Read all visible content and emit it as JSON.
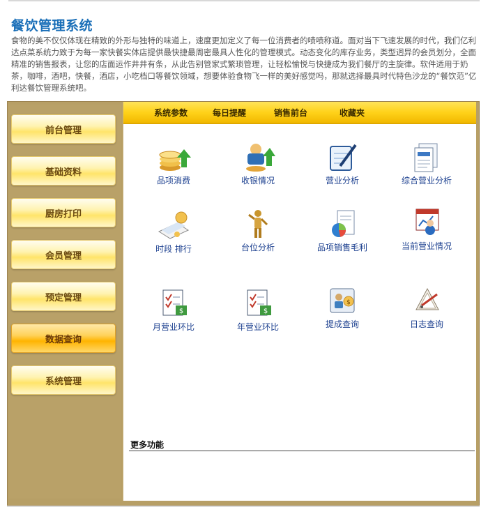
{
  "page": {
    "title": "餐饮管理系统",
    "intro": "食物的美不仅仅体现在精致的外形与独特的味道上，速度更加定义了每一位消费者的啧啧称道。面对当下飞速发展的时代，我们亿利达点菜系统力致于为每一家快餐实体店提供最快捷最周密最具人性化的管理模式。动态变化的库存业务，类型迥异的会员划分，全面精准的销售报表，让您的店面运作井井有条，从此告别管家式繁琐管理，让轻松愉悦与快捷成为我们餐厅的主旋律。软件适用于奶茶，咖啡，酒吧，快餐，酒店，小吃档口等餐饮领域，想要体验食物飞一样的美好感觉吗，那就选择最具时代特色沙龙的“餐饮范”亿利达餐饮管理系统吧。"
  },
  "sidebar": {
    "items": [
      {
        "label": "前台管理",
        "active": false
      },
      {
        "label": "基础资料",
        "active": false
      },
      {
        "label": "厨房打印",
        "active": false
      },
      {
        "label": "会员管理",
        "active": false
      },
      {
        "label": "预定管理",
        "active": false
      },
      {
        "label": "数据查询",
        "active": true
      },
      {
        "label": "系统管理",
        "active": false
      }
    ]
  },
  "tabs": [
    {
      "label": "系统参数"
    },
    {
      "label": "每日提醒"
    },
    {
      "label": "销售前台"
    },
    {
      "label": "收藏夹"
    }
  ],
  "tiles": [
    {
      "label": "品项消费",
      "icon": "coins-chart-icon"
    },
    {
      "label": "收银情况",
      "icon": "cashier-icon"
    },
    {
      "label": "营业分析",
      "icon": "notebook-pen-icon"
    },
    {
      "label": "综合营业分析",
      "icon": "document-report-icon"
    },
    {
      "label": "时段 排行",
      "icon": "time-ranking-icon"
    },
    {
      "label": "台位分析",
      "icon": "figure-icon"
    },
    {
      "label": "品项销售毛利",
      "icon": "pie-document-icon"
    },
    {
      "label": "当前营业情况",
      "icon": "current-status-icon"
    },
    {
      "label": "月营业环比",
      "icon": "checklist-money-icon"
    },
    {
      "label": "年营业环比",
      "icon": "checklist-money-icon"
    },
    {
      "label": "提成查询",
      "icon": "commission-icon"
    },
    {
      "label": "日志查询",
      "icon": "log-pencil-icon"
    }
  ],
  "more": {
    "label": "更多功能"
  },
  "colors": {
    "title": "#1a6fb8",
    "frame": "#b79f66",
    "tabbar": "#ffd21a",
    "link": "#1b3f8f"
  }
}
